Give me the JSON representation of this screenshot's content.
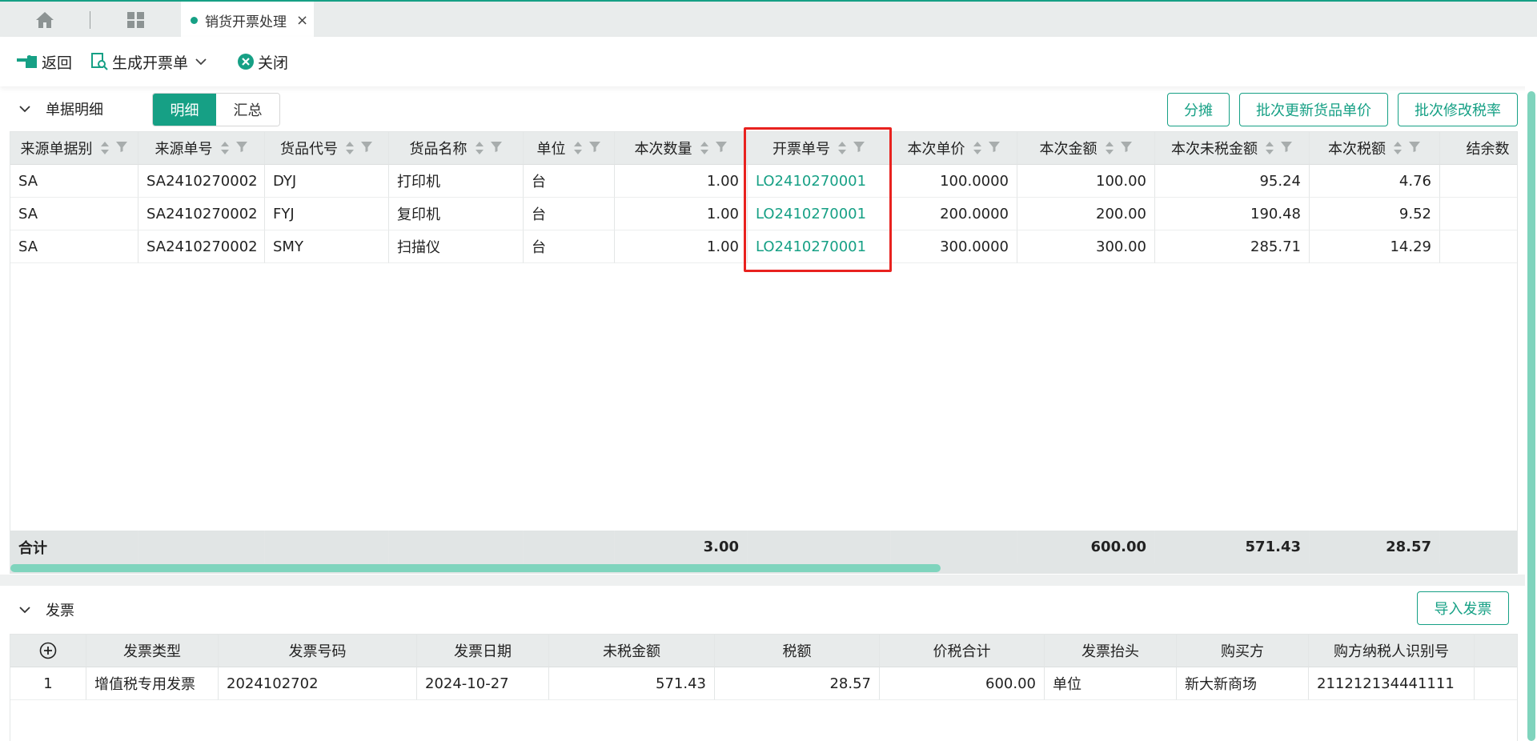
{
  "tabs": {
    "active_label": "销货开票处理"
  },
  "toolbar": {
    "back_label": "返回",
    "generate_label": "生成开票单",
    "close_label": "关闭"
  },
  "detail": {
    "title": "单据明细",
    "seg_detail": "明细",
    "seg_summary": "汇总",
    "btn_split": "分摊",
    "btn_batch_price": "批次更新货品单价",
    "btn_batch_tax": "批次修改税率",
    "columns": [
      "来源单据别",
      "来源单号",
      "货品代号",
      "货品名称",
      "单位",
      "本次数量",
      "开票单号",
      "本次单价",
      "本次金额",
      "本次未税金额",
      "本次税额",
      "结余数"
    ],
    "rows": [
      [
        "SA",
        "SA2410270002",
        "DYJ",
        "打印机",
        "台",
        "1.00",
        "LO2410270001",
        "100.0000",
        "100.00",
        "95.24",
        "4.76",
        ""
      ],
      [
        "SA",
        "SA2410270002",
        "FYJ",
        "复印机",
        "台",
        "1.00",
        "LO2410270001",
        "200.0000",
        "200.00",
        "190.48",
        "9.52",
        ""
      ],
      [
        "SA",
        "SA2410270002",
        "SMY",
        "扫描仪",
        "台",
        "1.00",
        "LO2410270001",
        "300.0000",
        "300.00",
        "285.71",
        "14.29",
        ""
      ]
    ],
    "total_label": "合计",
    "totals": {
      "qty": "3.00",
      "amount": "600.00",
      "untaxed": "571.43",
      "tax": "28.57"
    }
  },
  "invoice": {
    "title": "发票",
    "btn_import": "导入发票",
    "columns": [
      "发票类型",
      "发票号码",
      "发票日期",
      "未税金额",
      "税额",
      "价税合计",
      "发票抬头",
      "购买方",
      "购方纳税人识别号"
    ],
    "rows": [
      [
        "1",
        "增值税专用发票",
        "2024102702",
        "2024-10-27",
        "571.43",
        "28.57",
        "600.00",
        "单位",
        "新大新商场",
        "211212134441111"
      ]
    ]
  },
  "colors": {
    "accent": "#16a085",
    "highlight": "#e8221f"
  }
}
